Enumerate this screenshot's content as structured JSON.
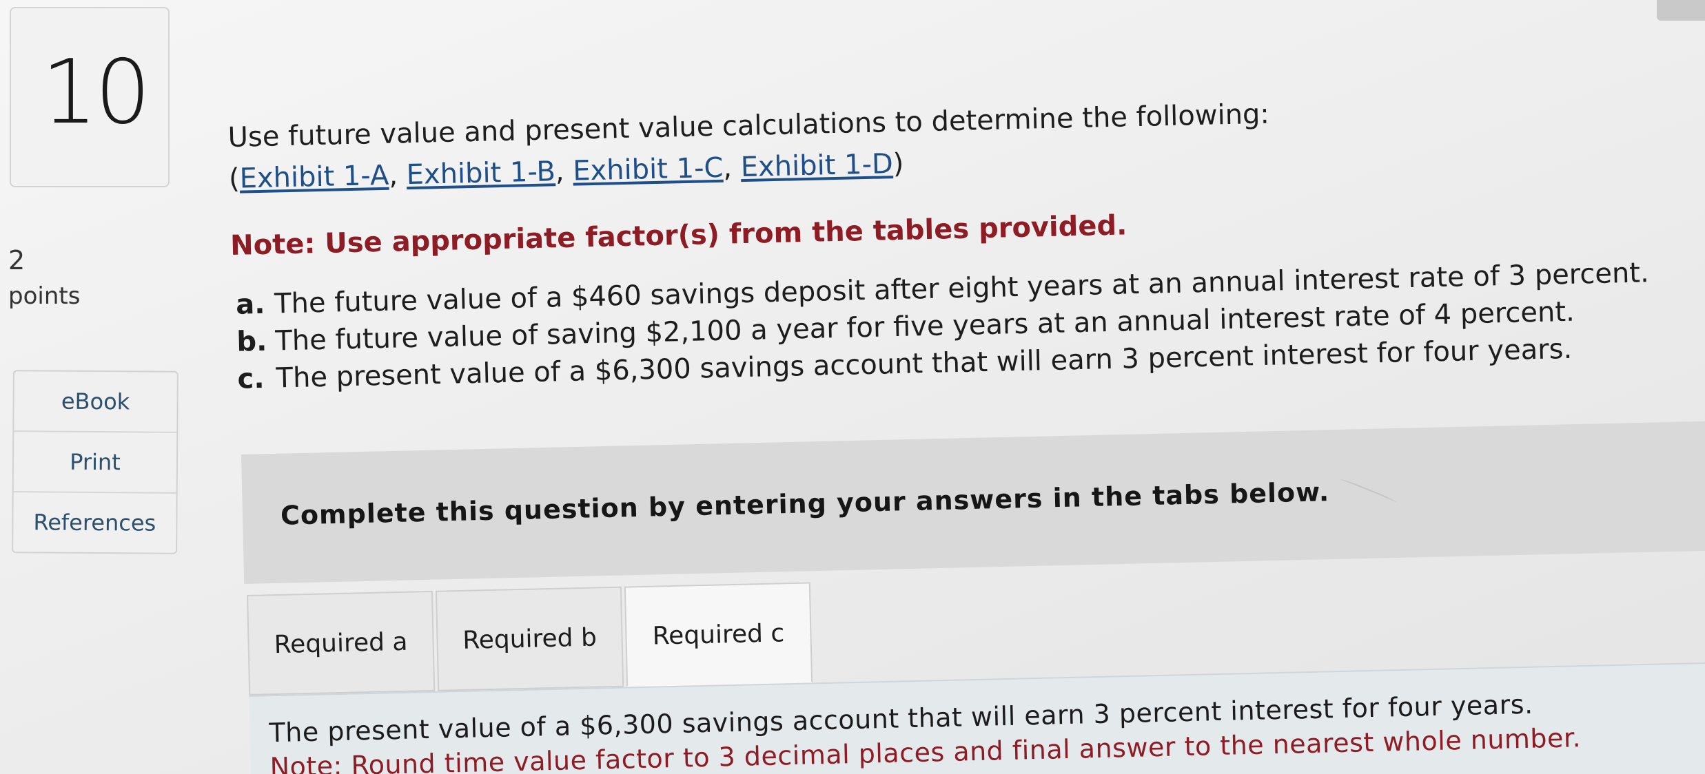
{
  "question": {
    "number": "10",
    "points_value": "2",
    "points_label": "points"
  },
  "side_links": [
    "eBook",
    "Print",
    "References"
  ],
  "content": {
    "intro": "Use future value and present value calculations to determine the following:",
    "exhibit_open": "(",
    "exhibits": [
      "Exhibit 1-A",
      "Exhibit 1-B",
      "Exhibit 1-C",
      "Exhibit 1-D"
    ],
    "exhibit_sep": ", ",
    "exhibit_close": ")",
    "note": "Note: Use appropriate factor(s) from the tables provided.",
    "items": [
      {
        "letter": "a.",
        "text": "The future value of a $460 savings deposit after eight years at an annual interest rate of 3 percent."
      },
      {
        "letter": "b.",
        "text": "The future value of saving $2,100 a year for five years at an annual interest rate of 4 percent."
      },
      {
        "letter": "c.",
        "text": "The present value of a $6,300 savings account that will earn 3 percent interest for four years."
      }
    ]
  },
  "instruction": "Complete this question by entering your answers in the tabs below.",
  "tabs": [
    {
      "label": "Required a"
    },
    {
      "label": "Required b"
    },
    {
      "label": "Required c"
    }
  ],
  "active_tab": 2,
  "panel": {
    "text": "The present value of a $6,300 savings account that will earn 3 percent interest for four years.",
    "note": "Note: Round time value factor to 3 decimal places and final answer to the nearest whole number."
  },
  "colors": {
    "link": "#1f4f88",
    "note": "#8e1c25",
    "band": "#d9d9d9"
  }
}
